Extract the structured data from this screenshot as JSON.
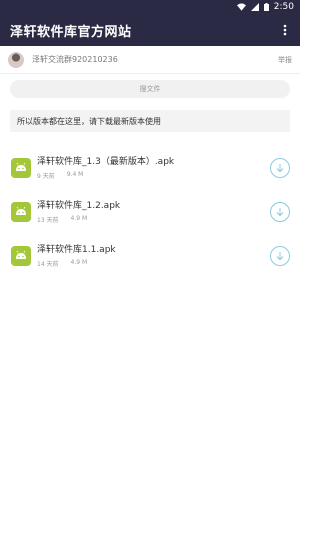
{
  "statusbar": {
    "time": "2:50"
  },
  "appbar": {
    "title": "泽轩软件库官方网站",
    "menu_icon": "more-vert-icon"
  },
  "user": {
    "name": "泽轩交流群920210236",
    "report_label": "举报"
  },
  "search": {
    "placeholder": "搜文件"
  },
  "notice": {
    "text": "所以版本都在这里，请下载最新版本使用"
  },
  "files": [
    {
      "name": "泽轩软件库_1.3（最新版本）.apk",
      "age": "9 天前",
      "size": "9.4 M"
    },
    {
      "name": "泽轩软件库_1.2.apk",
      "age": "13 天前",
      "size": "4.9 M"
    },
    {
      "name": "泽轩软件库1.1.apk",
      "age": "14 天前",
      "size": "4.9 M"
    }
  ],
  "colors": {
    "appbar": "#2b2a45",
    "apk_green": "#a4c639",
    "download_accent": "#8cc9e0"
  }
}
